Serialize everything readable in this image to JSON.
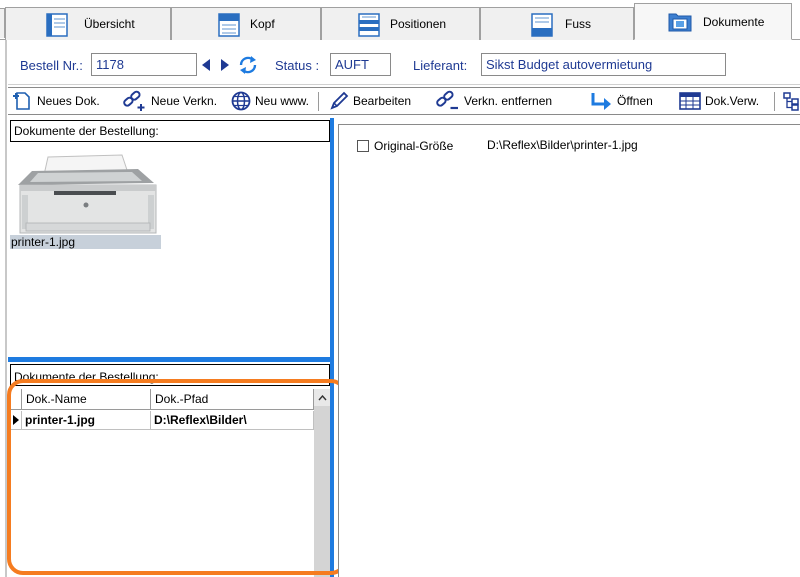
{
  "tabs": [
    {
      "label": "Übersicht",
      "icon": "overview-icon",
      "active": false
    },
    {
      "label": "Kopf",
      "icon": "header-icon",
      "active": false
    },
    {
      "label": "Positionen",
      "icon": "positions-icon",
      "active": false
    },
    {
      "label": "Fuss",
      "icon": "footer-icon",
      "active": false
    },
    {
      "label": "Dokumente",
      "icon": "documents-icon",
      "active": true
    }
  ],
  "header": {
    "order_label": "Bestell Nr.:",
    "order_value": "1178",
    "status_label": "Status :",
    "status_value": "AUFT",
    "supplier_label": "Lieferant:",
    "supplier_value": "Sikst Budget autovermietung"
  },
  "toolbar": {
    "new_doc": "Neues Dok.",
    "new_link": "Neue Verkn.",
    "new_www": "Neu www.",
    "edit": "Bearbeiten",
    "remove_link": "Verkn. entfernen",
    "open": "Öffnen",
    "doc_manage": "Dok.Verw."
  },
  "thumbnails_panel": {
    "title": "Dokumente der Bestellung:",
    "items": [
      {
        "caption": "printer-1.jpg"
      }
    ]
  },
  "documents_grid": {
    "title": "Dokumente der Bestellung:",
    "columns": [
      "Dok.-Name",
      "Dok.-Pfad"
    ],
    "rows": [
      [
        "printer-1.jpg",
        "D:\\Reflex\\Bilder\\"
      ]
    ]
  },
  "preview": {
    "original_size_label": "Original-Größe",
    "original_size_checked": false,
    "path": "D:\\Reflex\\Bilder\\printer-1.jpg"
  },
  "colors": {
    "accent_blue": "#1e7be0",
    "label_blue": "#1f3a93",
    "highlight_orange": "#f57c20"
  }
}
